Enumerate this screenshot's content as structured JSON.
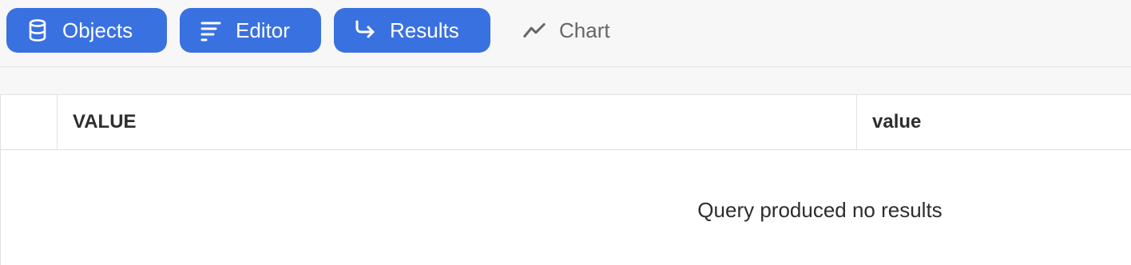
{
  "toolbar": {
    "tabs": [
      {
        "label": "Objects",
        "icon": "database-icon",
        "active": true
      },
      {
        "label": "Editor",
        "icon": "lines-icon",
        "active": true
      },
      {
        "label": "Results",
        "icon": "arrow-return-icon",
        "active": true
      },
      {
        "label": "Chart",
        "icon": "line-chart-icon",
        "active": false
      }
    ]
  },
  "table": {
    "columns": [
      "VALUE",
      "value"
    ],
    "empty_message": "Query produced no results"
  },
  "colors": {
    "accent": "#3a71e0",
    "background": "#f7f7f7",
    "inactive_text": "#666666"
  }
}
